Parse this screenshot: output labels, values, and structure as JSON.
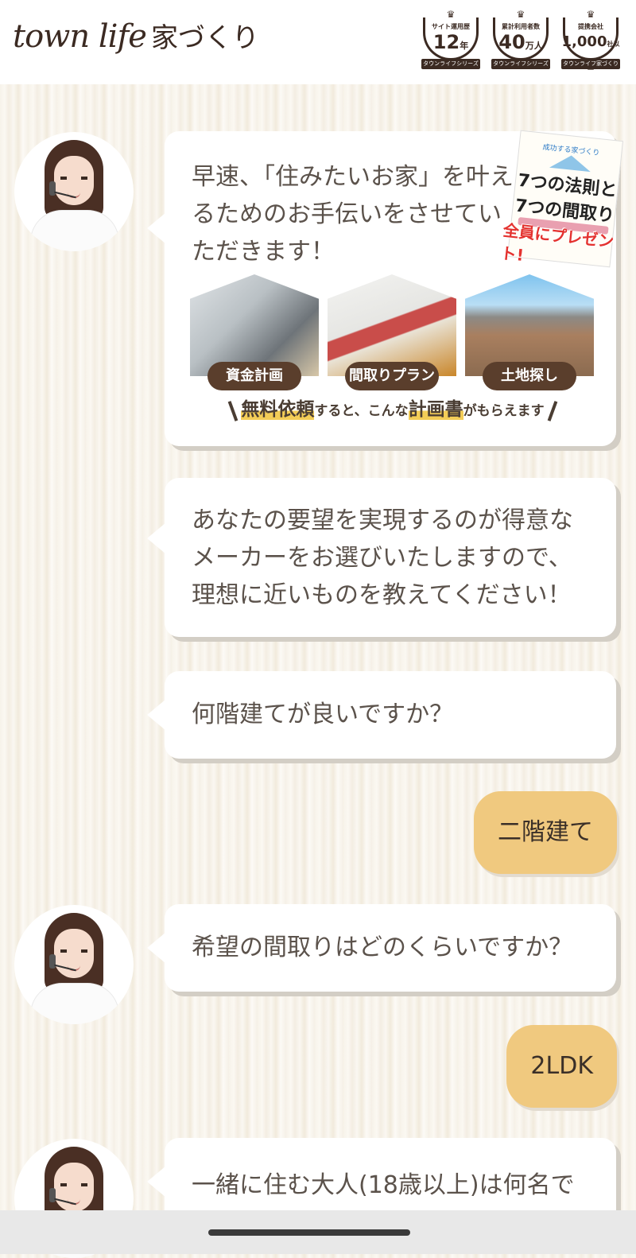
{
  "header": {
    "logo_en": "town life",
    "logo_ja": "家づくり",
    "badges": [
      {
        "caption": "サイト運用歴",
        "value": "12",
        "unit": "年",
        "ribbon": "タウンライフシリーズ"
      },
      {
        "caption": "累計利用者数",
        "value": "40",
        "unit": "万人",
        "ribbon": "タウンライフシリーズ"
      },
      {
        "caption": "提携会社",
        "value": "1,000",
        "unit": "社以上",
        "ribbon": "タウンライフ家づくり"
      }
    ]
  },
  "chat": {
    "msg1": {
      "text": "早速、「住みたいお家」を叶えるためのお手伝いをさせていただきます！",
      "book_title_1": "7つの法則と",
      "book_title_2": "7つの間取り",
      "book_kicker": "成功する家づくり",
      "gift": "全員にプレゼント!",
      "cards": [
        "資金計画",
        "間取りプラン",
        "土地探し"
      ],
      "promo_hl1": "無料依頼",
      "promo_mid": "すると、こんな",
      "promo_hl2": "計画書",
      "promo_end": "がもらえます"
    },
    "msg2": "あなたの要望を実現するのが得意なメーカーをお選びいたしますので、理想に近いものを教えてください！",
    "msg3": "何階建てが良いですか？",
    "reply1": "二階建て",
    "msg4": "希望の間取りはどのくらいですか？",
    "reply2": "2LDK",
    "msg5": "一緒に住む大人(18歳以上)は何名で"
  },
  "colors": {
    "reply_bg": "#f0c97f",
    "pill_bg": "#5a3e2c",
    "highlight": "#f3cd57",
    "gift_red": "#e4322f"
  }
}
